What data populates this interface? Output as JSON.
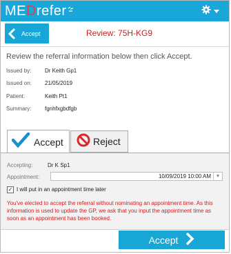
{
  "app": {
    "logo_me": "ME",
    "logo_d": "D",
    "logo_refer": "refer"
  },
  "header": {
    "back_label": "Accept",
    "review_title": "Review: 75H-KG9"
  },
  "intro_text": "Review the referral information below then click Accept.",
  "referral": {
    "issued_by_label": "Issued by:",
    "issued_by": "Dr Keith Gp1",
    "issued_on_label": "Issued on:",
    "issued_on": "21/05/2019",
    "patient_label": "Patient:",
    "patient": "Keith Pt1",
    "summary_label": "Summary:",
    "summary": "fgnhfxgbdfgb"
  },
  "tabs": [
    {
      "label": "Accept",
      "icon": "checkmark-icon",
      "selected": true
    },
    {
      "label": "Reject",
      "icon": "no-entry-icon",
      "selected": false
    }
  ],
  "accept_form": {
    "accepting_label": "Accepting:",
    "accepting_value": "Dr K Sp1",
    "appointment_label": "Appointment:",
    "appointment_value": "10/09/2019 10:00 AM",
    "later_checkbox_label": "I will put in an appointment time later",
    "later_checked": true,
    "warning": "You've elected to accept the referral without nominating an appointment time. As this information is used to update the GP, we ask that you input the appointment time as soon as an appointment has been booked."
  },
  "footer": {
    "accept_label": "Accept"
  },
  "colors": {
    "accent": "#17a6d6",
    "title_red": "#c82020",
    "warning_red": "#d31c1c",
    "reject_red": "#d9262b"
  }
}
